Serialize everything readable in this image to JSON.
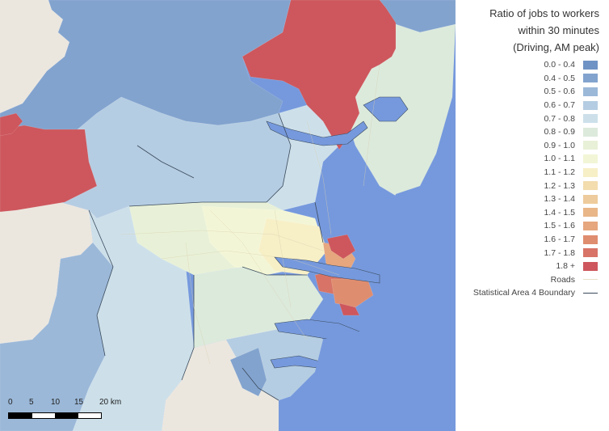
{
  "legend": {
    "title_lines": [
      "Ratio of jobs to workers",
      "within 30 minutes",
      "(Driving, AM peak)"
    ],
    "classes": [
      {
        "label": "0.0 - 0.4",
        "color": "#6f93c4"
      },
      {
        "label": "0.4 - 0.5",
        "color": "#82a3ce"
      },
      {
        "label": "0.5 - 0.6",
        "color": "#9bb8d8"
      },
      {
        "label": "0.6 - 0.7",
        "color": "#b5cde2"
      },
      {
        "label": "0.7 - 0.8",
        "color": "#cde0ea"
      },
      {
        "label": "0.8 - 0.9",
        "color": "#dceadc"
      },
      {
        "label": "0.9 - 1.0",
        "color": "#e8f1d7"
      },
      {
        "label": "1.0 - 1.1",
        "color": "#f3f6d6"
      },
      {
        "label": "1.1 - 1.2",
        "color": "#f7efc6"
      },
      {
        "label": "1.2 - 1.3",
        "color": "#f3dcae"
      },
      {
        "label": "1.3 - 1.4",
        "color": "#eecb9c"
      },
      {
        "label": "1.4 - 1.5",
        "color": "#e9b688"
      },
      {
        "label": "1.5 - 1.6",
        "color": "#e6a67e"
      },
      {
        "label": "1.6 - 1.7",
        "color": "#df8d6f"
      },
      {
        "label": "1.7 - 1.8",
        "color": "#d77467"
      },
      {
        "label": "1.8 +",
        "color": "#cd575d"
      }
    ],
    "roads_label": "Roads",
    "roads_color": "#e8dfc8",
    "boundary_label": "Statistical Area 4 Boundary",
    "boundary_color": "#3a4a5c"
  },
  "scale_bar": {
    "ticks": [
      "0",
      "5",
      "10",
      "15",
      "20 km"
    ]
  },
  "map": {
    "ocean_color": "#7699dd",
    "land_outside_color": "#ebe7df"
  }
}
